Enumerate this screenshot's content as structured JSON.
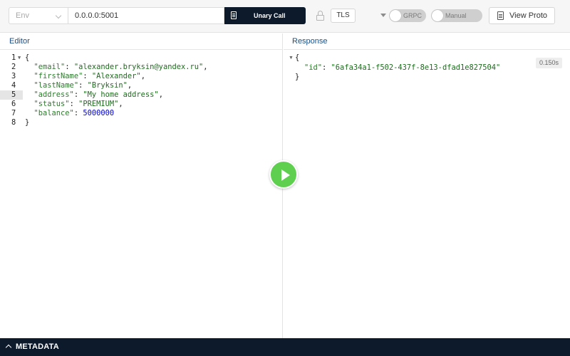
{
  "toolbar": {
    "env_placeholder": "Env",
    "address": "0.0.0.0:5001",
    "call_type": "Unary Call",
    "tls_label": "TLS",
    "grpc_label": "GRPC",
    "manual_label": "Manual",
    "view_proto_label": "View Proto"
  },
  "editor": {
    "title": "Editor",
    "lines": [
      {
        "num": "1",
        "parts": [
          {
            "t": "p",
            "v": "{"
          }
        ]
      },
      {
        "num": "2",
        "parts": [
          {
            "t": "p",
            "v": "  "
          },
          {
            "t": "k",
            "v": "\"email\""
          },
          {
            "t": "p",
            "v": ": "
          },
          {
            "t": "s",
            "v": "\"alexander.bryksin@yandex.ru\""
          },
          {
            "t": "p",
            "v": ","
          }
        ]
      },
      {
        "num": "3",
        "parts": [
          {
            "t": "p",
            "v": "  "
          },
          {
            "t": "k",
            "v": "\"firstName\""
          },
          {
            "t": "p",
            "v": ": "
          },
          {
            "t": "s",
            "v": "\"Alexander\""
          },
          {
            "t": "p",
            "v": ","
          }
        ]
      },
      {
        "num": "4",
        "parts": [
          {
            "t": "p",
            "v": "  "
          },
          {
            "t": "k",
            "v": "\"lastName\""
          },
          {
            "t": "p",
            "v": ": "
          },
          {
            "t": "s",
            "v": "\"Bryksin\""
          },
          {
            "t": "p",
            "v": ","
          }
        ]
      },
      {
        "num": "5",
        "parts": [
          {
            "t": "p",
            "v": "  "
          },
          {
            "t": "k",
            "v": "\"address\""
          },
          {
            "t": "p",
            "v": ": "
          },
          {
            "t": "s",
            "v": "\"My home address\""
          },
          {
            "t": "p",
            "v": ","
          }
        ]
      },
      {
        "num": "6",
        "parts": [
          {
            "t": "p",
            "v": "  "
          },
          {
            "t": "k",
            "v": "\"status\""
          },
          {
            "t": "p",
            "v": ": "
          },
          {
            "t": "s",
            "v": "\"PREMIUM\""
          },
          {
            "t": "p",
            "v": ","
          }
        ]
      },
      {
        "num": "7",
        "parts": [
          {
            "t": "p",
            "v": "  "
          },
          {
            "t": "k",
            "v": "\"balance\""
          },
          {
            "t": "p",
            "v": ": "
          },
          {
            "t": "n",
            "v": "5000000"
          }
        ]
      },
      {
        "num": "8",
        "parts": [
          {
            "t": "p",
            "v": "}"
          }
        ]
      }
    ],
    "active_line": 5
  },
  "response": {
    "title": "Response",
    "open_brace": "{",
    "key": "\"id\"",
    "value": "\"6afa34a1-f502-437f-8e13-dfad1e827504\"",
    "close_brace": "}",
    "time": "0.150s"
  },
  "bottom_bar": {
    "label": "METADATA"
  },
  "colors": {
    "dark_navy": "#0c1a2b",
    "play_green": "#5fcf4f",
    "header_blue": "#1b4f84"
  }
}
